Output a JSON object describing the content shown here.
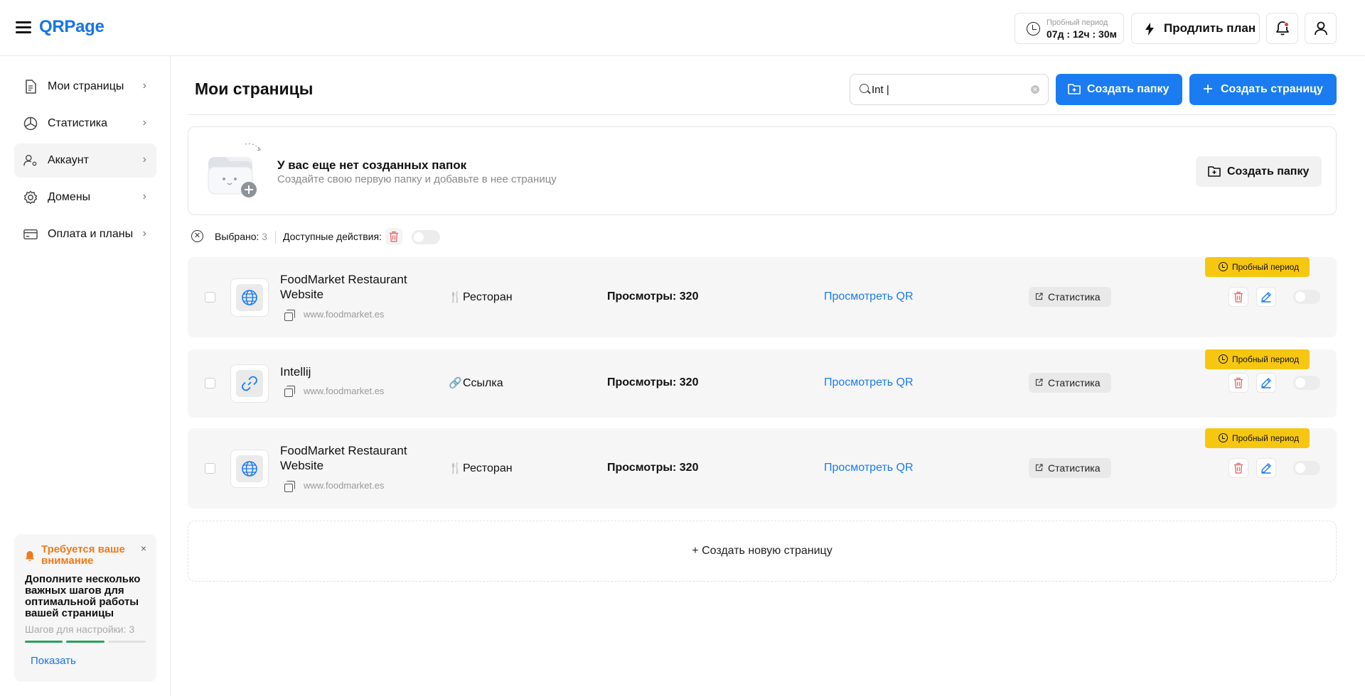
{
  "header": {
    "logo": "QRPage",
    "trial_label": "Пробный период",
    "trial_value": "07д : 12ч : 30м",
    "extend_label": "Продлить план"
  },
  "sidebar": {
    "items": [
      {
        "label": "Мои страницы",
        "icon": "document-icon"
      },
      {
        "label": "Статистика",
        "icon": "pie-chart-icon"
      },
      {
        "label": "Аккаунт",
        "icon": "user-settings-icon"
      },
      {
        "label": "Домены",
        "icon": "gear-icon"
      },
      {
        "label": "Оплата и планы",
        "icon": "card-icon"
      }
    ],
    "attention": {
      "title": "Требуется ваше внимание",
      "text": "Дополните несколько важных шагов для оптимальной работы вашей страницы",
      "steps": "Шагов для настройки: 3",
      "show": "Показать",
      "close": "×"
    }
  },
  "main": {
    "title": "Мои страницы",
    "search_value": "Int |",
    "create_folder": "Создать папку",
    "create_page": "Создать страницу",
    "empty_folders": {
      "title": "У вас еще нет созданных папок",
      "subtitle": "Создайте свою первую папку и добавьте в нее страницу",
      "button": "Создать папку"
    },
    "selection": {
      "selected_label": "Выбрано:",
      "selected_count": "3",
      "actions_label": "Доступные действия:"
    },
    "rows": [
      {
        "name": "FoodMarket Restaurant Website",
        "url": "www.foodmarket.es",
        "type": "Ресторан",
        "views": "Просмотры: 320",
        "qr": "Просмотреть QR",
        "stats": "Статистика",
        "badge": "Пробный период"
      },
      {
        "name": "Intellij",
        "url": "www.foodmarket.es",
        "type": "Ссылка",
        "views": "Просмотры: 320",
        "qr": "Просмотреть QR",
        "stats": "Статистика",
        "badge": "Пробный период"
      },
      {
        "name": "FoodMarket Restaurant Website",
        "url": "www.foodmarket.es",
        "type": "Ресторан",
        "views": "Просмотры: 320",
        "qr": "Просмотреть QR",
        "stats": "Статистика",
        "badge": "Пробный период"
      }
    ],
    "new_page": "+ Создать новую страницу"
  },
  "colors": {
    "accent": "#1a7cf0",
    "badge": "#f6c711",
    "attention": "#f07a1a",
    "danger": "#e57373"
  }
}
